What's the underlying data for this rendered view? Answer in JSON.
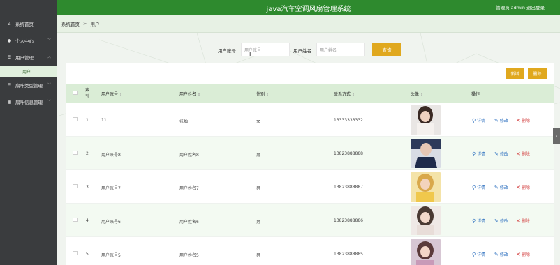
{
  "header": {
    "title": "java汽车空调风扇管理系统",
    "admin": "管理员 admin",
    "logout": "退出登录"
  },
  "sidebar": {
    "items": [
      {
        "label": "系统首页",
        "icon": "home-icon"
      },
      {
        "label": "个人中心",
        "icon": "user-icon"
      },
      {
        "label": "用户管理",
        "icon": "list-icon"
      },
      {
        "label": "用户",
        "icon": ""
      },
      {
        "label": "扇叶类型管理",
        "icon": "list-icon"
      },
      {
        "label": "扇叶信息管理",
        "icon": "grid-icon"
      }
    ]
  },
  "breadcrumb": {
    "home": "系统首页",
    "sep": ">",
    "current": "用户"
  },
  "search": {
    "account_label": "用户账号",
    "account_placeholder": "用户账号",
    "name_label": "用户姓名",
    "name_placeholder": "用户姓名",
    "button": "查询"
  },
  "toolbar": {
    "add": "新增",
    "delete": "删除"
  },
  "table": {
    "headers": {
      "index": "索引",
      "account": "用户账号",
      "name": "用户姓名",
      "gender": "性别",
      "phone": "联系方式",
      "avatar": "头像",
      "ops": "操作"
    },
    "rows": [
      {
        "index": "1",
        "account": "11",
        "name": "张灿",
        "gender": "女",
        "phone": "13333333332"
      },
      {
        "index": "2",
        "account": "用户账号8",
        "name": "用户姓名8",
        "gender": "男",
        "phone": "13823888888"
      },
      {
        "index": "3",
        "account": "用户账号7",
        "name": "用户姓名7",
        "gender": "男",
        "phone": "13823888887"
      },
      {
        "index": "4",
        "account": "用户账号6",
        "name": "用户姓名6",
        "gender": "男",
        "phone": "13823888886"
      },
      {
        "index": "5",
        "account": "用户账号5",
        "name": "用户姓名5",
        "gender": "男",
        "phone": "13823888885"
      }
    ],
    "actions": {
      "view": "详情",
      "edit": "修改",
      "delete": "删除"
    }
  },
  "colors": {
    "header": "#2e8a2e",
    "sidebar": "#3a3c3e",
    "accent": "#e0a81e",
    "table_head": "#daedd6"
  }
}
